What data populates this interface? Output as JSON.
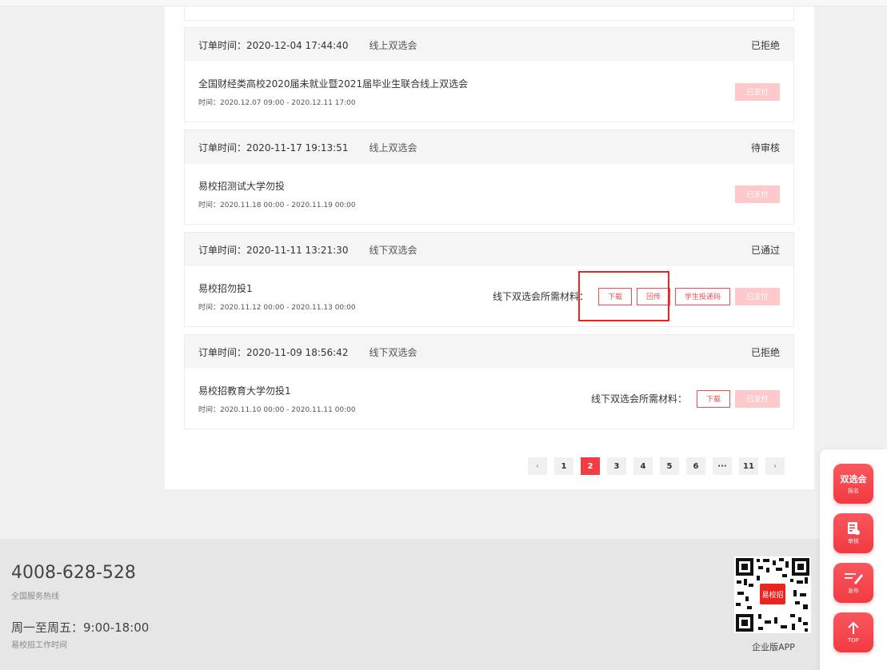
{
  "orders": [
    {
      "time_label": "订单时间：2020-12-04 17:44:40",
      "type": "线上双选会",
      "status": "已拒绝",
      "name": "全国财经类高校2020届未就业暨2021届毕业生联合线上双选会",
      "date": "时间：2020.12.07 09:00 - 2020.12.11 17:00",
      "paid_label": "已支付"
    },
    {
      "time_label": "订单时间：2020-11-17 19:13:51",
      "type": "线上双选会",
      "status": "待审核",
      "name": "易校招测试大学勿投",
      "date": "时间：2020.11.18 00:00 - 2020.11.19 00:00",
      "paid_label": "已支付"
    },
    {
      "time_label": "订单时间：2020-11-11 13:21:30",
      "type": "线下双选会",
      "status": "已通过",
      "name": "易校招勿投1",
      "date": "时间：2020.11.12 00:00 - 2020.11.13 00:00",
      "materials_label": "线下双选会所需材料：",
      "download_label": "下载",
      "upload_label": "回传",
      "delivery_code_label": "学生投递码",
      "paid_label": "已支付"
    },
    {
      "time_label": "订单时间：2020-11-09 18:56:42",
      "type": "线下双选会",
      "status": "已拒绝",
      "name": "易校招教育大学勿投1",
      "date": "时间：2020.11.10 00:00 - 2020.11.11 00:00",
      "materials_label": "线下双选会所需材料：",
      "download_label": "下载",
      "paid_label": "已支付"
    }
  ],
  "pagination": {
    "prev": "‹",
    "pages": [
      "1",
      "2",
      "3",
      "4",
      "5",
      "6",
      "···",
      "11"
    ],
    "next": "›",
    "current": "2"
  },
  "footer": {
    "hotline": "4008-628-528",
    "hotline_label": "全国服务热线",
    "hours": "周一至周五：9:00-18:00",
    "hours_label": "易校招工作时间",
    "qr_label": "企业版APP",
    "qr_logo": "易校招"
  },
  "side": {
    "fair_big": "双选会",
    "fair_small": "报名",
    "review_small": "审核",
    "publish_small": "发布",
    "top_small": "TOP"
  },
  "colors": {
    "accent": "#f33d45",
    "paid_disabled": "#ffc9cc",
    "highlight": "#e8251f"
  }
}
